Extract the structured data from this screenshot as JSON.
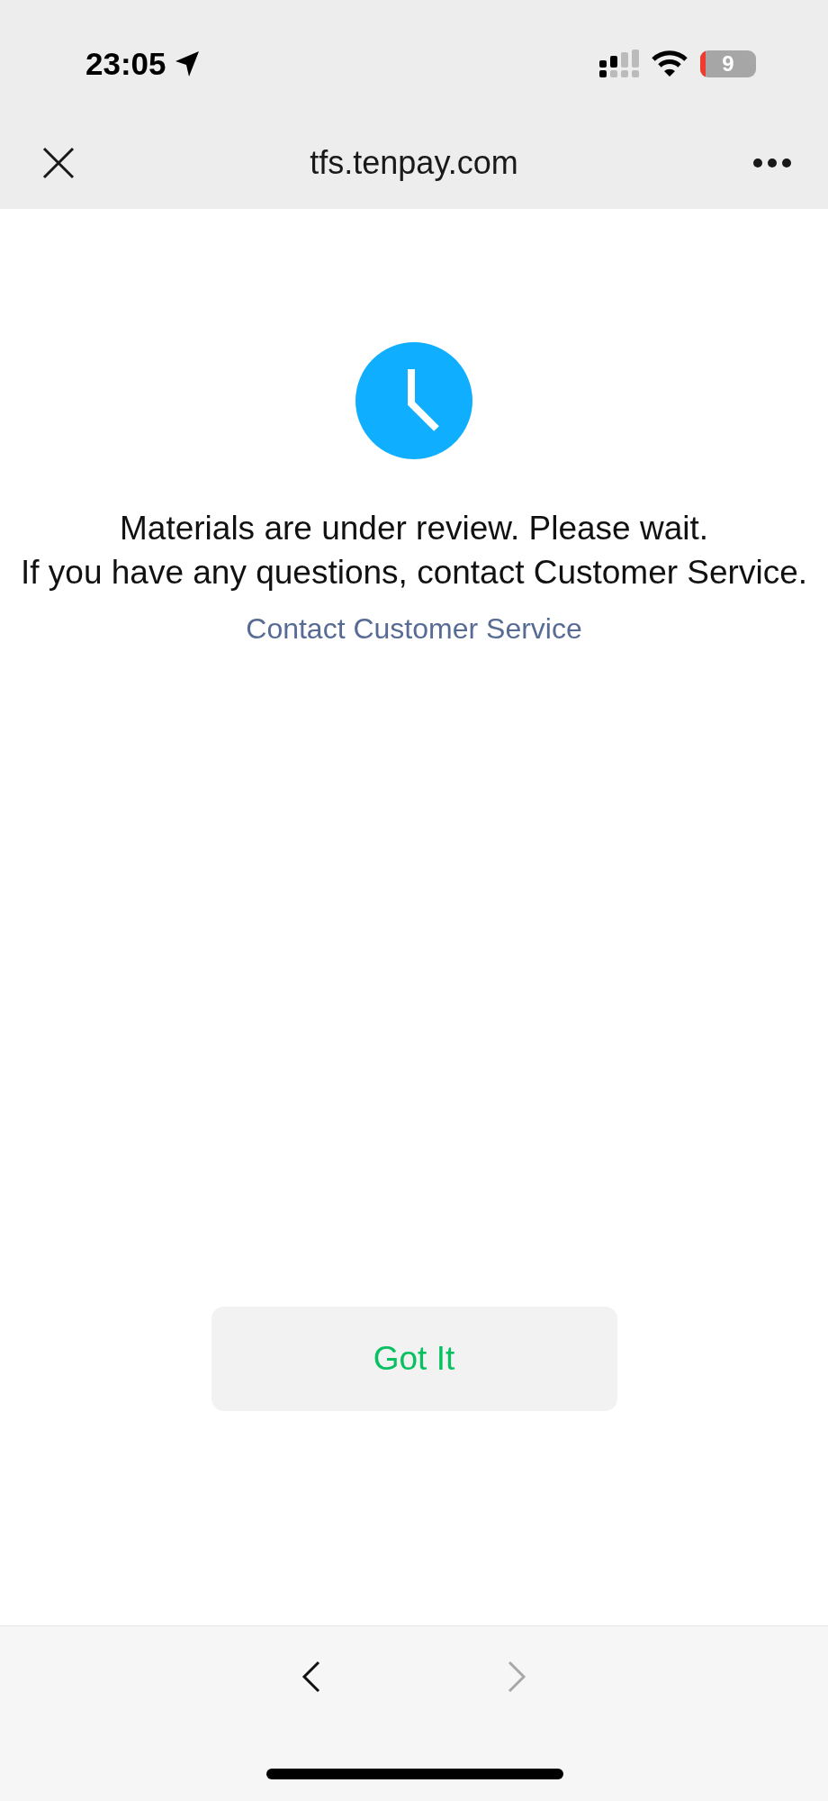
{
  "status_bar": {
    "time": "23:05",
    "battery": "9"
  },
  "nav_bar": {
    "title": "tfs.tenpay.com"
  },
  "message": {
    "lines": [
      "Materials are under review. Please wait.",
      "If you have any questions, contact Customer Service."
    ],
    "link": "Contact Customer Service"
  },
  "button": {
    "label": "Got It"
  },
  "toolbar": {
    "back": {
      "disabled": false
    },
    "forward": {
      "disabled": true
    }
  }
}
